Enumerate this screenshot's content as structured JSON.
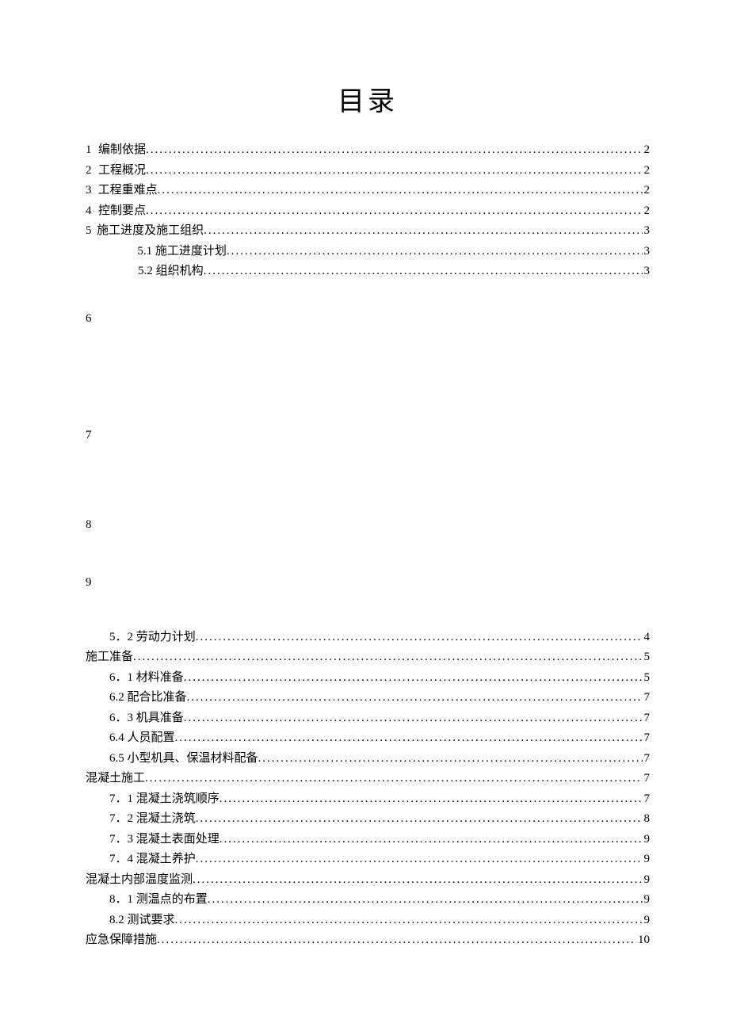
{
  "title": "目录",
  "entries": [
    {
      "num": "1",
      "indent": 0,
      "text": "编制依据",
      "page": "2"
    },
    {
      "num": "2",
      "indent": 0,
      "text": "工程概况",
      "page": "2"
    },
    {
      "num": "3",
      "indent": 0,
      "text": "工程重难点",
      "page": "2"
    },
    {
      "num": "4",
      "indent": 0,
      "text": "控制要点",
      "page": "2"
    },
    {
      "num": "5",
      "indent": 0,
      "text": "施工进度及施工组织",
      "page": "3"
    },
    {
      "num": "",
      "indent": 1,
      "text": "5.1 施工进度计划",
      "page": "3"
    },
    {
      "num": "",
      "indent": 1,
      "text": "5.2 组织机构",
      "page": "3"
    }
  ],
  "standalone_numbers": [
    "6",
    "7",
    "8",
    "9"
  ],
  "entries2": [
    {
      "indent": 1,
      "text": "5．2 劳动力计划",
      "page": "4"
    },
    {
      "indent": 0,
      "text": "施工准备",
      "page": "5"
    },
    {
      "indent": 1,
      "text": "6．1 材料准备",
      "page": "5"
    },
    {
      "indent": 1,
      "text": "6.2 配合比准备",
      "page": "7"
    },
    {
      "indent": 1,
      "text": "6．3 机具准备",
      "page": "7"
    },
    {
      "indent": 1,
      "text": "6.4 人员配置",
      "page": "7"
    },
    {
      "indent": 1,
      "text": "6.5 小型机具、保温材料配备",
      "page": "7"
    },
    {
      "indent": 0,
      "text": "混凝土施工",
      "page": "7"
    },
    {
      "indent": 1,
      "text": "7．1 混凝土浇筑顺序",
      "page": "7"
    },
    {
      "indent": 1,
      "text": "7．2 混凝土浇筑",
      "page": "8"
    },
    {
      "indent": 1,
      "text": "7．3 混凝土表面处理",
      "page": "9"
    },
    {
      "indent": 1,
      "text": "7．4 混凝土养护",
      "page": "9"
    },
    {
      "indent": 0,
      "text": "混凝土内部温度监测",
      "page": "9"
    },
    {
      "indent": 1,
      "text": "8．1 测温点的布置",
      "page": "9"
    },
    {
      "indent": 1,
      "text": "8.2 测试要求",
      "page": "9"
    },
    {
      "indent": 0,
      "text": "应急保障措施",
      "page": "10"
    }
  ]
}
